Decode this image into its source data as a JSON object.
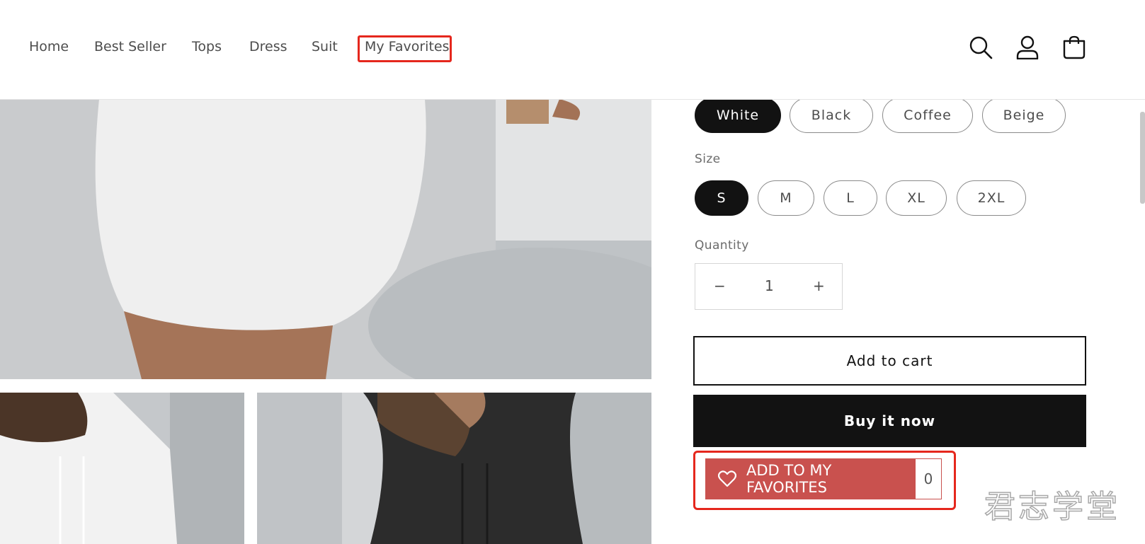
{
  "nav": {
    "items": [
      "Home",
      "Best Seller",
      "Tops",
      "Dress",
      "Suit",
      "My Favorites"
    ]
  },
  "header_icons": [
    "search-icon",
    "account-icon",
    "cart-icon"
  ],
  "product": {
    "colors": [
      "White",
      "Black",
      "Coffee",
      "Beige"
    ],
    "selected_color": "White",
    "size_label": "Size",
    "sizes": [
      "S",
      "M",
      "L",
      "XL",
      "2XL"
    ],
    "selected_size": "S",
    "quantity_label": "Quantity",
    "quantity": "1",
    "minus": "−",
    "plus": "+",
    "add_to_cart": "Add to cart",
    "buy_now": "Buy it now",
    "favorites_button": "ADD TO MY FAVORITES",
    "favorites_count": "0"
  },
  "watermark": "君志学堂",
  "colors": {
    "highlight": "#e5271d",
    "favorites": "#c9514e",
    "primary": "#121212"
  }
}
